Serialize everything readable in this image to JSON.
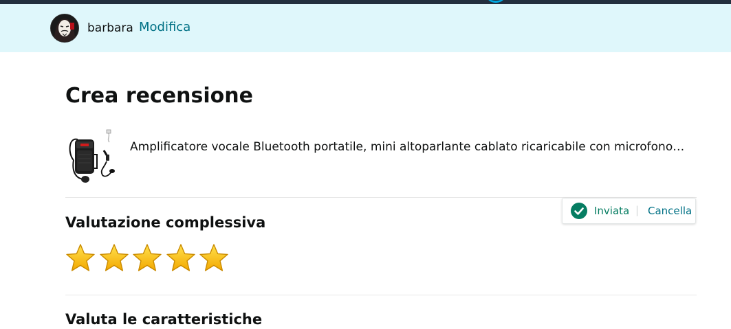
{
  "user": {
    "name": "barbara",
    "edit_label": "Modifica"
  },
  "page": {
    "title": "Crea recensione"
  },
  "product": {
    "name": "Amplificatore vocale Bluetooth portatile, mini altoparlante cablato ricaricabile con microfono…"
  },
  "overall_rating": {
    "heading": "Valutazione complessiva",
    "selected_stars": 5,
    "max_stars": 5,
    "status_label": "Inviata",
    "cancel_label": "Cancella"
  },
  "features": {
    "heading": "Valuta le caratteristiche"
  },
  "colors": {
    "top_bar": "#232f3e",
    "user_bar": "#dff7fb",
    "link": "#007185",
    "success": "#067d62",
    "star_fill": "#ffce00"
  }
}
